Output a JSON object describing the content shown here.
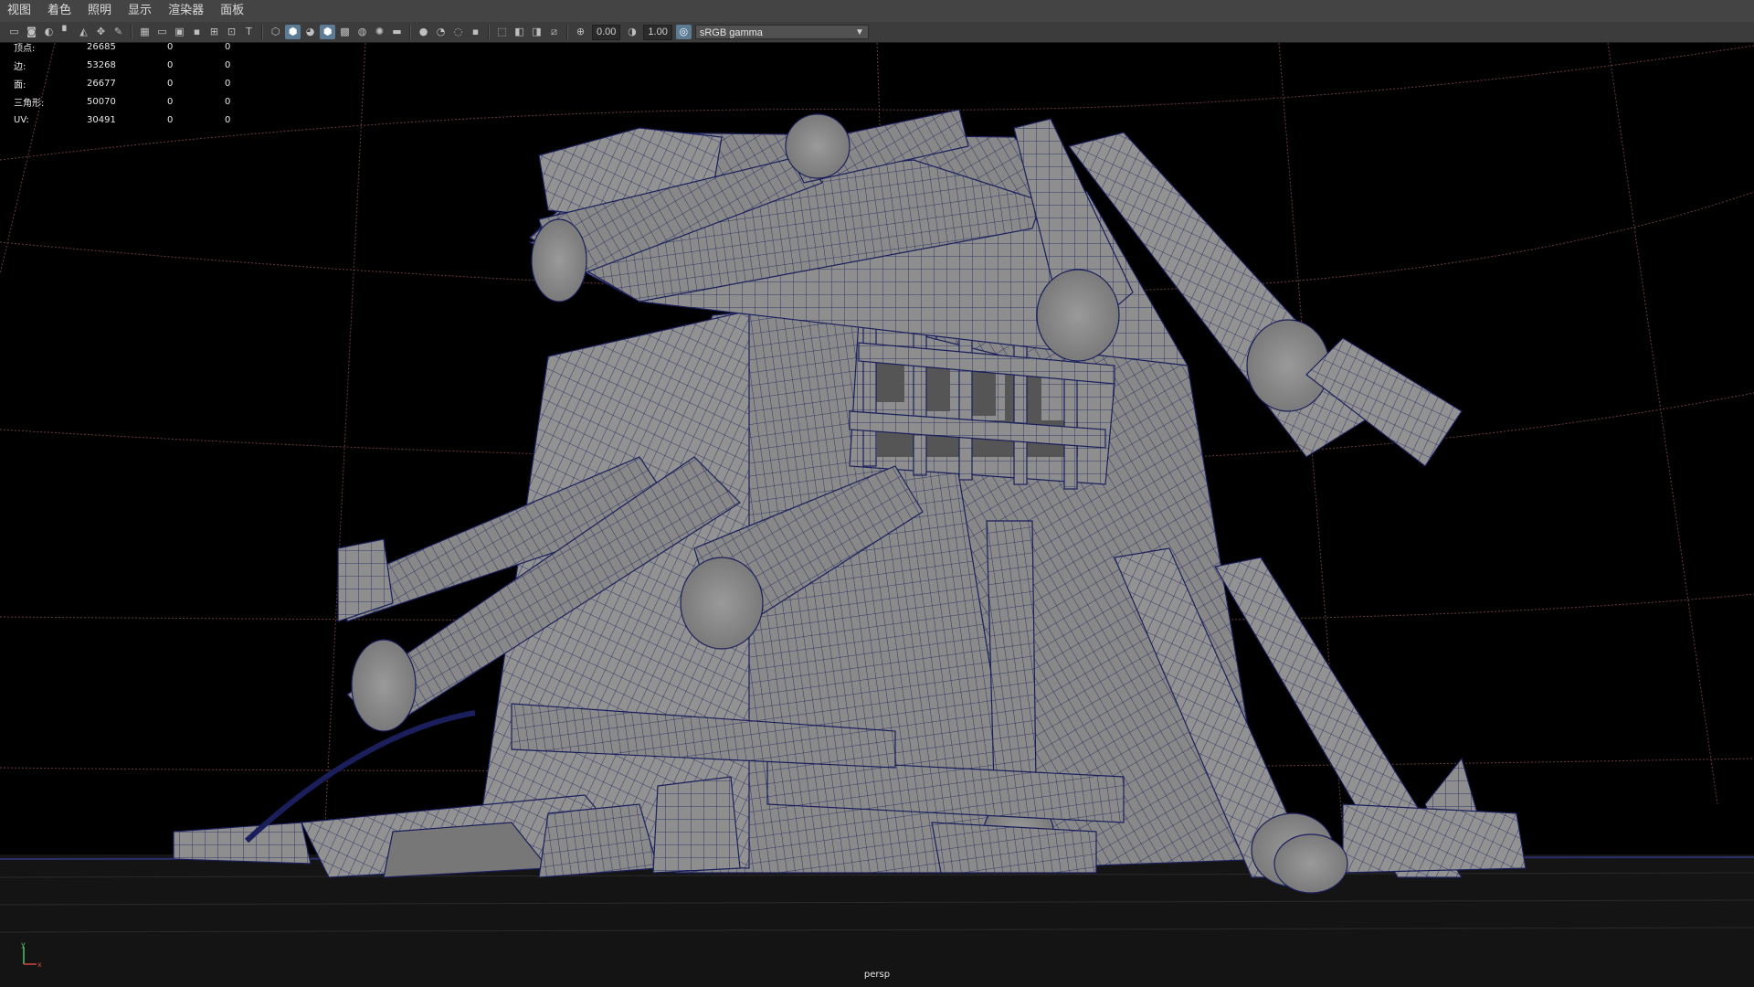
{
  "menu": {
    "items": [
      "视图",
      "着色",
      "照明",
      "显示",
      "渲染器",
      "面板"
    ]
  },
  "toolbar": {
    "exposure_value": "0.00",
    "gamma_value": "1.00",
    "color_space": "sRGB gamma",
    "icons_group1": [
      "camera-icon",
      "camera-lock-icon",
      "camera-attributes-icon",
      "bookmark-icon",
      "image-plane-icon",
      "2d-pan-icon",
      "grease-pencil-icon"
    ],
    "icons_group2": [
      "grid-icon",
      "film-gate-icon",
      "resolution-gate-icon",
      "gate-mask-icon",
      "field-chart-icon",
      "safe-action-icon",
      "safe-title-icon"
    ],
    "icons_group3": [
      "wireframe-icon",
      "smooth-shade-icon",
      "default-material-icon",
      "wireframe-on-shaded-icon",
      "xray-icon",
      "xray-joints-icon",
      "lights-icon",
      "shadows-icon"
    ],
    "icons_group4": [
      "ambient-occlusion-icon",
      "motion-blur-icon",
      "anti-aliasing-icon",
      "depth-of-field-icon"
    ],
    "icons_group5": [
      "isolate-select-icon",
      "xray-active-icon",
      "xray-all-icon",
      "backface-icon"
    ]
  },
  "hud": {
    "rows": [
      {
        "label": "顶点:",
        "v1": "26685",
        "v2": "0",
        "v3": "0"
      },
      {
        "label": "边:",
        "v1": "53268",
        "v2": "0",
        "v3": "0"
      },
      {
        "label": "面:",
        "v1": "26677",
        "v2": "0",
        "v3": "0"
      },
      {
        "label": "三角形:",
        "v1": "50070",
        "v2": "0",
        "v3": "0"
      },
      {
        "label": "UV:",
        "v1": "30491",
        "v2": "0",
        "v3": "0"
      }
    ]
  },
  "viewport": {
    "camera": "persp",
    "axis_y": "y",
    "axis_x": "x",
    "colors": {
      "background": "#000000",
      "mesh": "#8e8e8e",
      "wire": "#1a1f5c",
      "grid": "#5a3a3a",
      "ground": "#141414"
    }
  }
}
